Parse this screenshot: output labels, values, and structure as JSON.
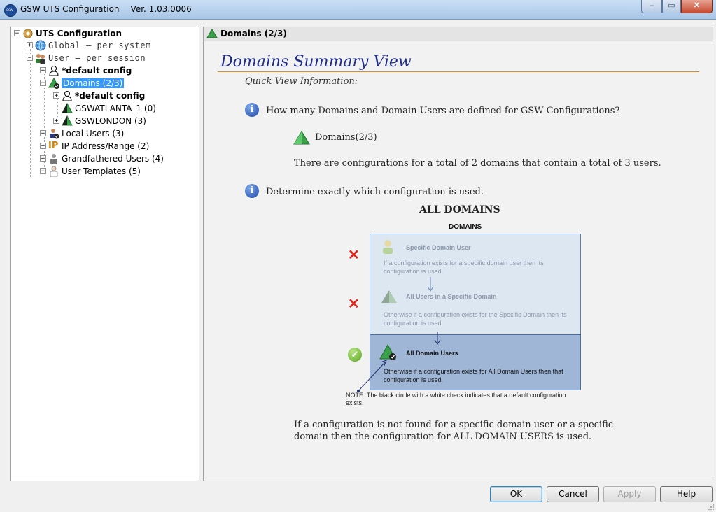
{
  "window": {
    "title": "GSW UTS Configuration",
    "version": "Ver. 1.03.0006",
    "app_icon_text": "GSW",
    "min": "–",
    "max": "▭",
    "close": "✕"
  },
  "tree": {
    "items": [
      {
        "label": "UTS Configuration"
      },
      {
        "label": "Global  – per system"
      },
      {
        "label": "User   – per session"
      },
      {
        "label": "*default config"
      },
      {
        "label": "Domains (2/3)"
      },
      {
        "label": "*default config"
      },
      {
        "label": "GSWATLANTA_1 (0)"
      },
      {
        "label": "GSWLONDON (3)"
      },
      {
        "label": "Local Users (3)"
      },
      {
        "label": "IP Address/Range (2)"
      },
      {
        "label": "Grandfathered Users (4)"
      },
      {
        "label": "User Templates (5)"
      }
    ],
    "ip_icon_text": "IP"
  },
  "panel": {
    "header": "Domains (2/3)",
    "title": "Domains Summary View",
    "quick_view": "Quick View Information:",
    "q1": "How many Domains and Domain Users are defined for GSW Configurations?",
    "domains_count": "Domains(2/3)",
    "q1_answer": "There are configurations for a total of 2 domains that contain a total of 3 users.",
    "q2": "Determine exactly which configuration is used.",
    "info_glyph": "i",
    "all_domains": "ALL DOMAINS",
    "diagram": {
      "header": "DOMAINS",
      "specific_user_title": "Specific Domain User",
      "specific_user_text": "If a configuration exists for a specific domain user then its configuration is used.",
      "specific_domain_title": "All Users in a Specific Domain",
      "specific_domain_text": "Otherwise if a configuration exists for the Specific Domain then its configuration is used",
      "all_users_title": "All Domain Users",
      "all_users_text": "Otherwise if a configuration exists for All Domain Users then that configuration is used.",
      "note": "NOTE: The black circle with a white check indicates that a default configuration exists.",
      "x_glyph": "✕",
      "check_glyph": "✓"
    },
    "bottom_text": "If a configuration is not found for a specific domain user or a specific domain then the configuration for ALL DOMAIN USERS is used."
  },
  "buttons": {
    "ok": "OK",
    "cancel": "Cancel",
    "apply": "Apply",
    "help": "Help"
  }
}
